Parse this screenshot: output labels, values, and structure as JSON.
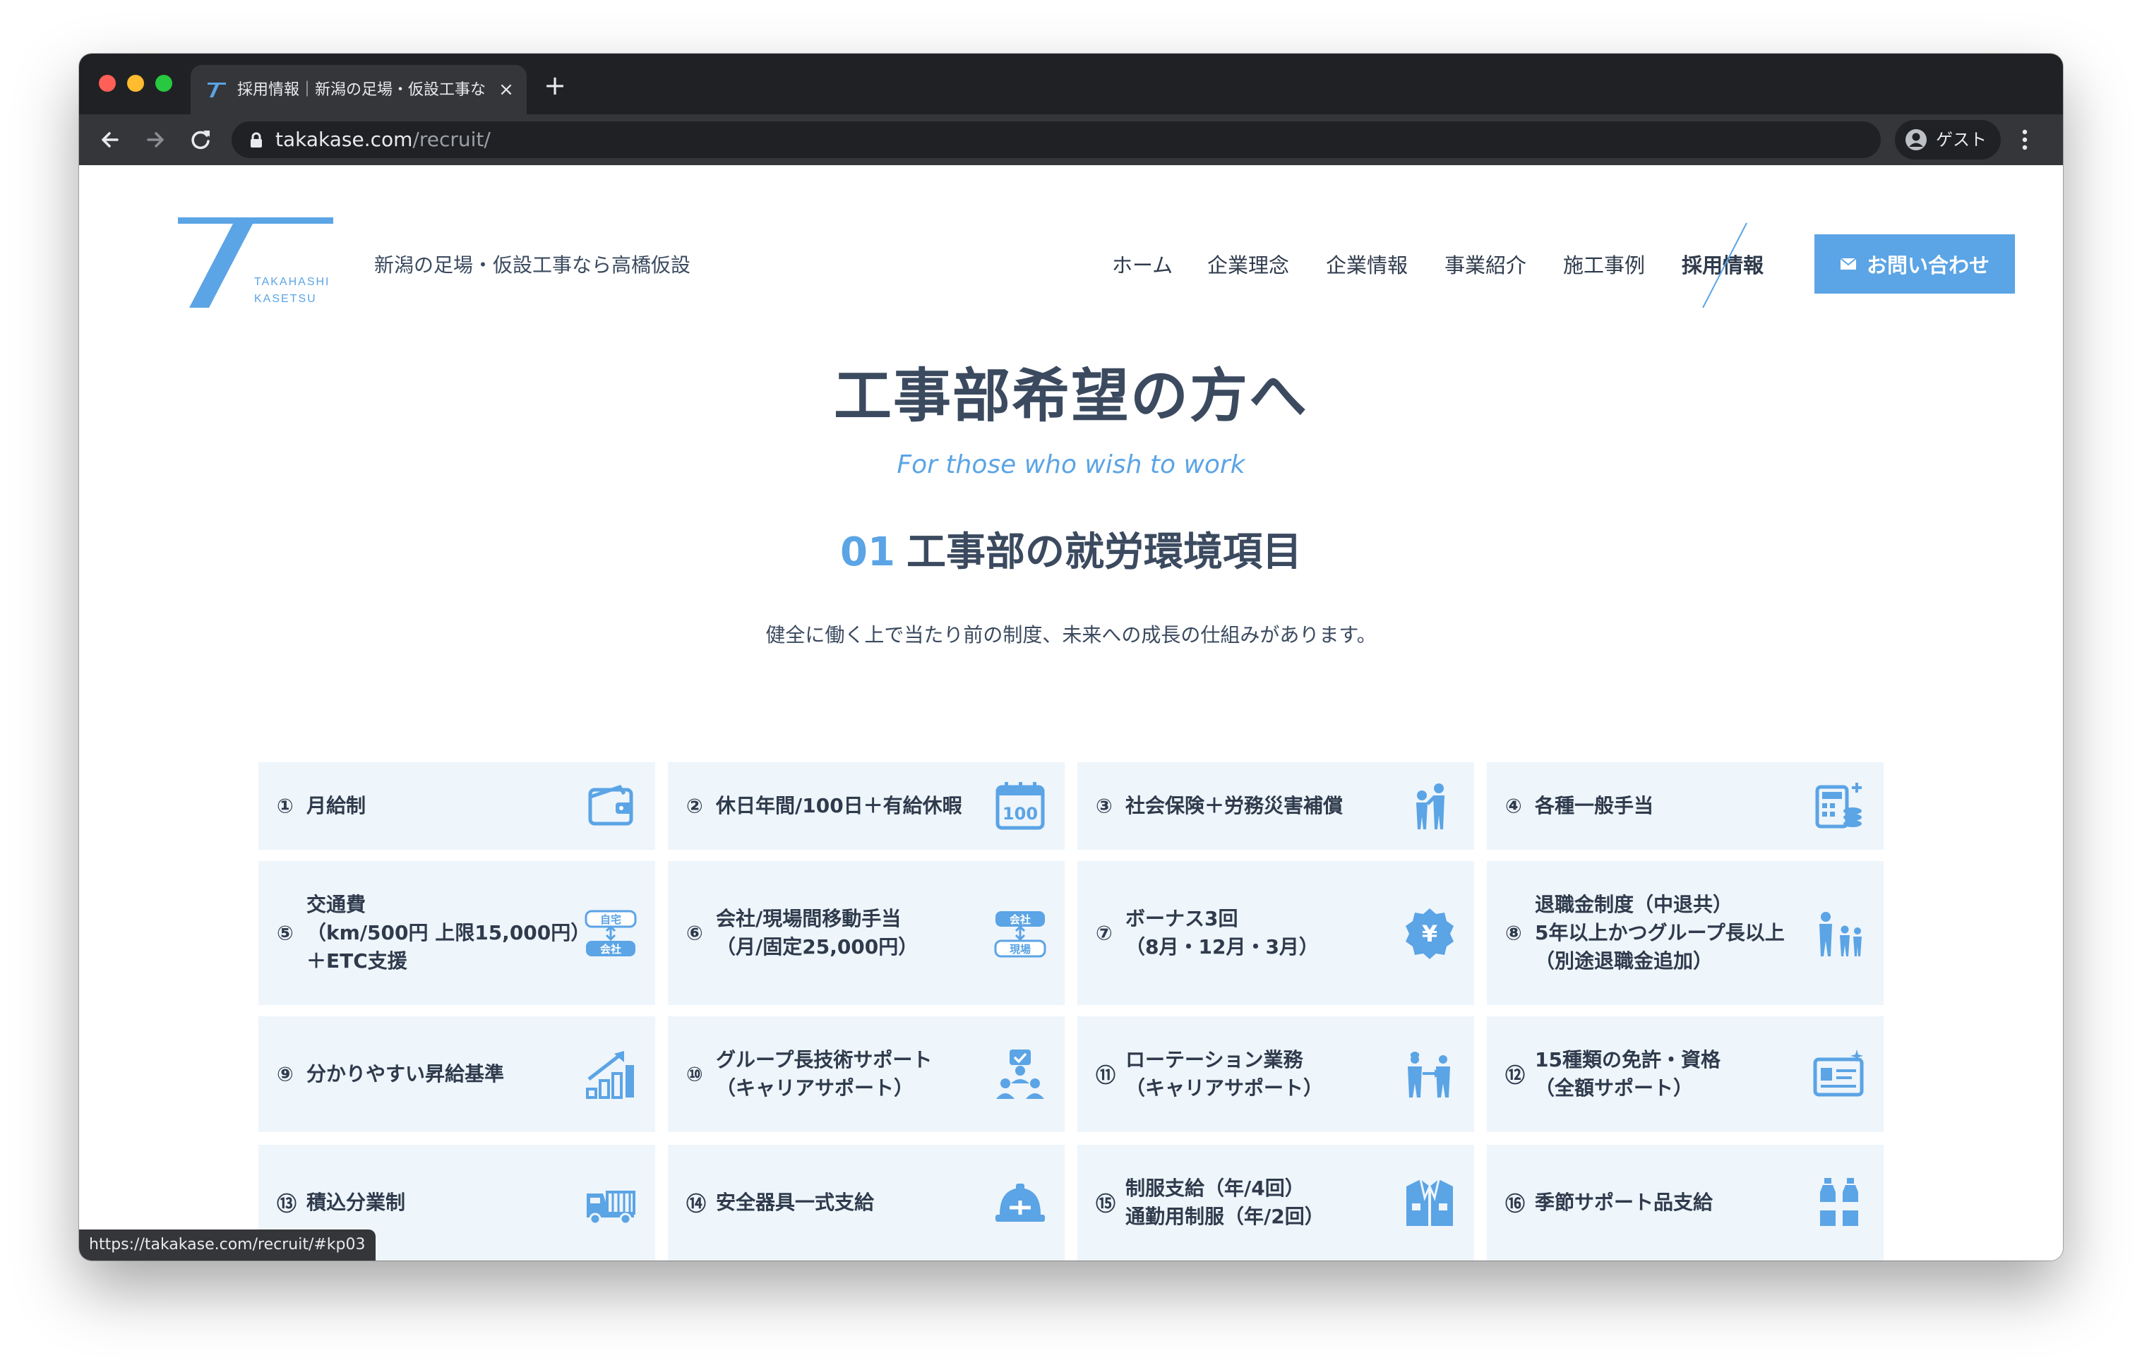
{
  "browser": {
    "tab_title": "採用情報｜新潟の足場・仮設工事なら高橋仮設",
    "url_host": "takakase.com",
    "url_path": "/recruit/",
    "profile_label": "ゲスト",
    "status_url": "https://takakase.com/recruit/#kp03"
  },
  "header": {
    "logo_text_1": "TAKAHASHI",
    "logo_text_2": "KASETSU",
    "tagline": "新潟の足場・仮設工事なら高橋仮設",
    "nav": [
      "ホーム",
      "企業理念",
      "企業情報",
      "事業紹介",
      "施工事例",
      "採用情報"
    ],
    "active_nav": "採用情報",
    "contact_label": "お問い合わせ",
    "accent": "#5ba4e5"
  },
  "hero": {
    "title": "工事部希望の方へ",
    "subtitle": "For those who wish to work"
  },
  "section": {
    "number": "01",
    "title": "工事部の就労環境項目",
    "lead": "健全に働く上で当たり前の制度、未来への成長の仕組みがあります。"
  },
  "cards": [
    {
      "num": "①",
      "text": "月給制",
      "icon": "wallet-icon"
    },
    {
      "num": "②",
      "text": "休日年間/100日＋有給休暇",
      "icon": "calendar-100-icon"
    },
    {
      "num": "③",
      "text": "社会保険＋労務災害補償",
      "icon": "people-support-icon"
    },
    {
      "num": "④",
      "text": "各種一般手当",
      "icon": "calculator-coins-icon"
    },
    {
      "num": "⑤",
      "text": "交通費\n（km/500円 上限15,000円）\n＋ETC支援",
      "icon": "commute-home-office-icon",
      "icon_labels": [
        "自宅",
        "会社"
      ]
    },
    {
      "num": "⑥",
      "text": "会社/現場間移動手当\n（月/固定25,000円）",
      "icon": "commute-office-site-icon",
      "icon_labels": [
        "会社",
        "現場"
      ]
    },
    {
      "num": "⑦",
      "text": "ボーナス3回\n（8月・12月・3月）",
      "icon": "yen-badge-icon",
      "icon_labels": [
        "¥"
      ]
    },
    {
      "num": "⑧",
      "text": "退職金制度（中退共）\n5年以上かつグループ長以上\n（別途退職金追加）",
      "icon": "family-icon"
    },
    {
      "num": "⑨",
      "text": "分かりやすい昇給基準",
      "icon": "growth-chart-icon"
    },
    {
      "num": "⑩",
      "text": "グループ長技術サポート\n（キャリアサポート）",
      "icon": "mentor-icon"
    },
    {
      "num": "⑪",
      "text": "ローテーション業務\n（キャリアサポート）",
      "icon": "rotation-workers-icon"
    },
    {
      "num": "⑫",
      "text": "15種類の免許・資格\n（全額サポート）",
      "icon": "license-card-icon"
    },
    {
      "num": "⑬",
      "text": "積込分業制",
      "icon": "truck-icon"
    },
    {
      "num": "⑭",
      "text": "安全器具一式支給",
      "icon": "helmet-icon"
    },
    {
      "num": "⑮",
      "text": "制服支給（年/4回）\n通勤用制服（年/2回）",
      "icon": "uniform-icon"
    },
    {
      "num": "⑯",
      "text": "季節サポート品支給",
      "icon": "bottles-icon"
    }
  ]
}
